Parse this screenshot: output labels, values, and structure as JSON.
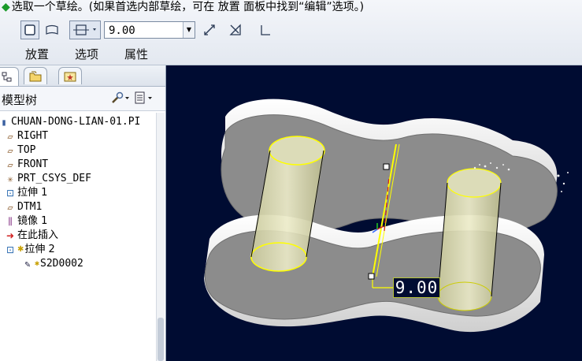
{
  "prompt": {
    "text": "选取一个草绘。(如果首选内部草绘，可在 放置 面板中找到“编辑”选项。)"
  },
  "dashboard": {
    "depth_value": "9.00",
    "tabs": [
      "放置",
      "选项",
      "属性"
    ]
  },
  "navigator": {
    "title": "模型树"
  },
  "tree": {
    "items": [
      {
        "label": "CHUAN-DONG-LIAN-01.PI",
        "icon": "part-icon"
      },
      {
        "label": "RIGHT",
        "icon": "datum-plane-icon"
      },
      {
        "label": "TOP",
        "icon": "datum-plane-icon"
      },
      {
        "label": "FRONT",
        "icon": "datum-plane-icon"
      },
      {
        "label": "PRT_CSYS_DEF",
        "icon": "csys-icon"
      },
      {
        "label": "拉伸 1",
        "icon": "extrude-icon"
      },
      {
        "label": "DTM1",
        "icon": "datum-plane-icon"
      },
      {
        "label": "镜像 1",
        "icon": "mirror-icon"
      },
      {
        "label": "在此插入",
        "icon": "insert-here-icon"
      },
      {
        "label": "拉伸 2",
        "icon": "extrude-icon"
      },
      {
        "label": "S2D0002",
        "icon": "sketch-icon"
      }
    ]
  },
  "viewport": {
    "dimension_label": "9.00",
    "colors": {
      "background": "#000c32",
      "part": "#8c8c8c",
      "edge": "#ffff00",
      "hole": "#d8d8b0"
    }
  }
}
